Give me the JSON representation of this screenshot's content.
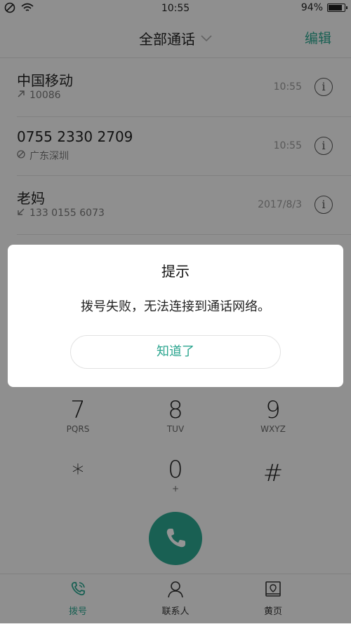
{
  "status_bar": {
    "time": "10:55",
    "battery": "94%",
    "battery_level": 0.94
  },
  "header": {
    "title": "全部通话",
    "edit_label": "编辑"
  },
  "calls": [
    {
      "name": "中国移动",
      "detail": "10086",
      "direction": "outgoing",
      "time": "10:55"
    },
    {
      "name": "0755 2330 2709",
      "detail": "广东深圳",
      "direction": "failed",
      "time": "10:55"
    },
    {
      "name": "老妈",
      "detail": "133 0155 6073",
      "direction": "incoming",
      "time": "2017/8/3"
    }
  ],
  "keypad": [
    {
      "digit": "7",
      "letters": "PQRS"
    },
    {
      "digit": "8",
      "letters": "TUV"
    },
    {
      "digit": "9",
      "letters": "WXYZ"
    },
    {
      "digit": "*",
      "letters": ""
    },
    {
      "digit": "0",
      "letters": "+"
    },
    {
      "digit": "#",
      "letters": ""
    }
  ],
  "tabs": [
    {
      "label": "拨号",
      "icon": "phone-icon",
      "active": true
    },
    {
      "label": "联系人",
      "icon": "contact-icon",
      "active": false
    },
    {
      "label": "黄页",
      "icon": "yellow-pages-icon",
      "active": false
    }
  ],
  "dialog": {
    "title": "提示",
    "message": "拨号失败，无法连接到通话网络。",
    "button": "知道了"
  },
  "colors": {
    "accent": "#2ba58f",
    "overlay": "rgba(0,0,0,0.42)"
  }
}
